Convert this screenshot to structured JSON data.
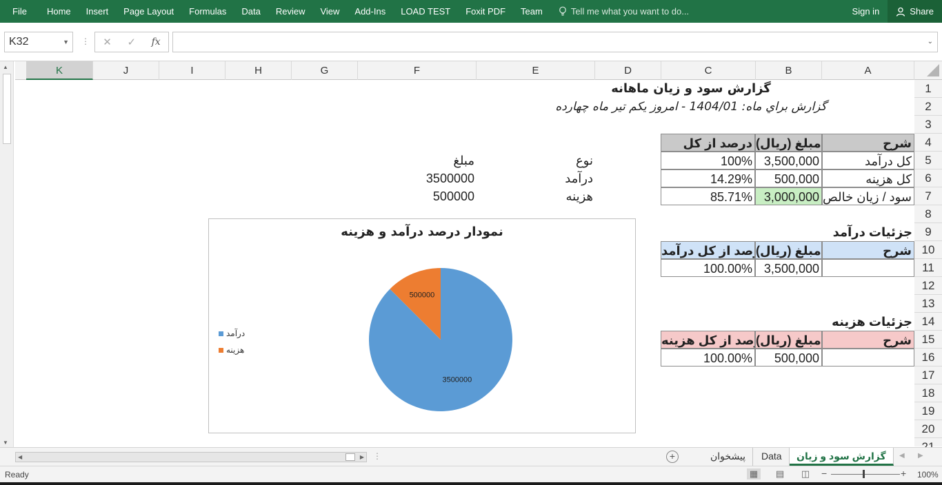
{
  "ribbon": {
    "tabs": [
      "File",
      "Home",
      "Insert",
      "Page Layout",
      "Formulas",
      "Data",
      "Review",
      "View",
      "Add-Ins",
      "LOAD TEST",
      "Foxit PDF",
      "Team"
    ],
    "tell_me": "Tell me what you want to do...",
    "sign_in": "Sign in",
    "share": "Share"
  },
  "formula_bar": {
    "name_box": "K32",
    "cancel": "✕",
    "enter": "✓",
    "fx": "fx",
    "formula": ""
  },
  "columns": [
    "K",
    "J",
    "I",
    "H",
    "G",
    "F",
    "E",
    "D",
    "C",
    "B",
    "A"
  ],
  "selected_column": "K",
  "rows": [
    "1",
    "2",
    "3",
    "4",
    "5",
    "6",
    "7",
    "8",
    "9",
    "10",
    "11",
    "12",
    "13",
    "14",
    "15",
    "16",
    "17",
    "18",
    "19",
    "20",
    "21"
  ],
  "sheet": {
    "title": "گزارش سود و زیان ماهانه",
    "subtitle": "گزارش براي ماه: 1404/01 - امروز یکم تیر ماه چهارده",
    "summary": {
      "headers": [
        "شرح",
        "مبلغ (ریال)",
        "درصد از کل"
      ],
      "rows": [
        [
          "کل درآمد",
          "3,500,000",
          "100%"
        ],
        [
          "کل هزینه",
          "500,000",
          "14.29%"
        ],
        [
          "سود / زیان خالص",
          "3,000,000",
          "85.71%"
        ]
      ]
    },
    "income_details": {
      "title": "جزئیات درآمد",
      "headers": [
        "شرح",
        "مبلغ (ریال)",
        "درصد از کل درآمد"
      ],
      "row": [
        "",
        "3,500,000",
        "100.00%"
      ]
    },
    "expense_details": {
      "title": "جزئیات هزینه",
      "headers": [
        "شرح",
        "مبلغ (ریال)",
        "درصد از کل هزینه"
      ],
      "row": [
        "",
        "500,000",
        "100.00%"
      ]
    },
    "side_table": {
      "headers": [
        "نوع",
        "مبلغ"
      ],
      "rows": [
        [
          "درآمد",
          "3500000"
        ],
        [
          "هزینه",
          "500000"
        ]
      ]
    },
    "colors": {
      "summary_header": "#c9c9c9",
      "income_header": "#cfe2f7",
      "expense_header": "#f6c9c9",
      "profit_cell": "#c8eec3"
    }
  },
  "chart_data": {
    "type": "pie",
    "title": "نمودار درصد درآمد و هزینه",
    "categories": [
      "درآمد",
      "هزینه"
    ],
    "values": [
      3500000,
      500000
    ],
    "data_labels": [
      "3500000",
      "500000"
    ],
    "colors": [
      "#5b9bd5",
      "#ed7d31"
    ],
    "legend": "left"
  },
  "sheet_tabs": {
    "tabs": [
      "گزارش سود و زیان",
      "Data",
      "پیشخوان"
    ],
    "active": "گزارش سود و زیان",
    "add": "+"
  },
  "status": {
    "ready": "Ready",
    "zoom": "100%"
  }
}
